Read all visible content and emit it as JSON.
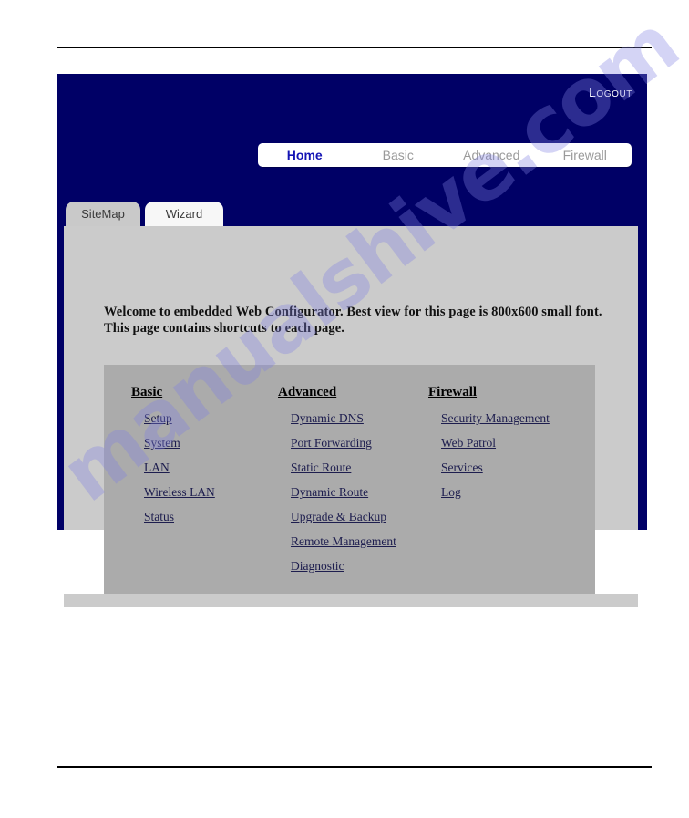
{
  "document": {
    "background": "#ffffff",
    "rule_color": "#000000"
  },
  "watermark": {
    "text": "manualshive.com",
    "color": "#8282e1"
  },
  "screenshot": {
    "header": {
      "background": "#000066",
      "logout_label": "Logout"
    },
    "main_nav": {
      "active_color": "#1414b4",
      "inactive_color": "#9a9a9a",
      "items": [
        {
          "label": "Home",
          "active": true
        },
        {
          "label": "Basic",
          "active": false
        },
        {
          "label": "Advanced",
          "active": false
        },
        {
          "label": "Firewall",
          "active": false
        }
      ]
    },
    "sub_tabs": [
      {
        "label": "SiteMap",
        "selected": true
      },
      {
        "label": "Wizard",
        "selected": false
      }
    ],
    "welcome": {
      "line1": "Welcome to embedded Web Configurator. Best view for this page is 800x600 small font.",
      "line2": "This page contains shortcuts to each page."
    },
    "sitemap": {
      "columns": [
        {
          "title": "Basic",
          "links": [
            "Setup",
            "System",
            "LAN",
            "Wireless LAN",
            "Status"
          ]
        },
        {
          "title": "Advanced",
          "links": [
            "Dynamic DNS",
            "Port Forwarding",
            "Static Route",
            "Dynamic Route",
            "Upgrade & Backup",
            "Remote Management",
            "Diagnostic"
          ]
        },
        {
          "title": "Firewall",
          "links": [
            "Security Management",
            "Web Patrol",
            "Services",
            "Log"
          ]
        }
      ]
    }
  }
}
